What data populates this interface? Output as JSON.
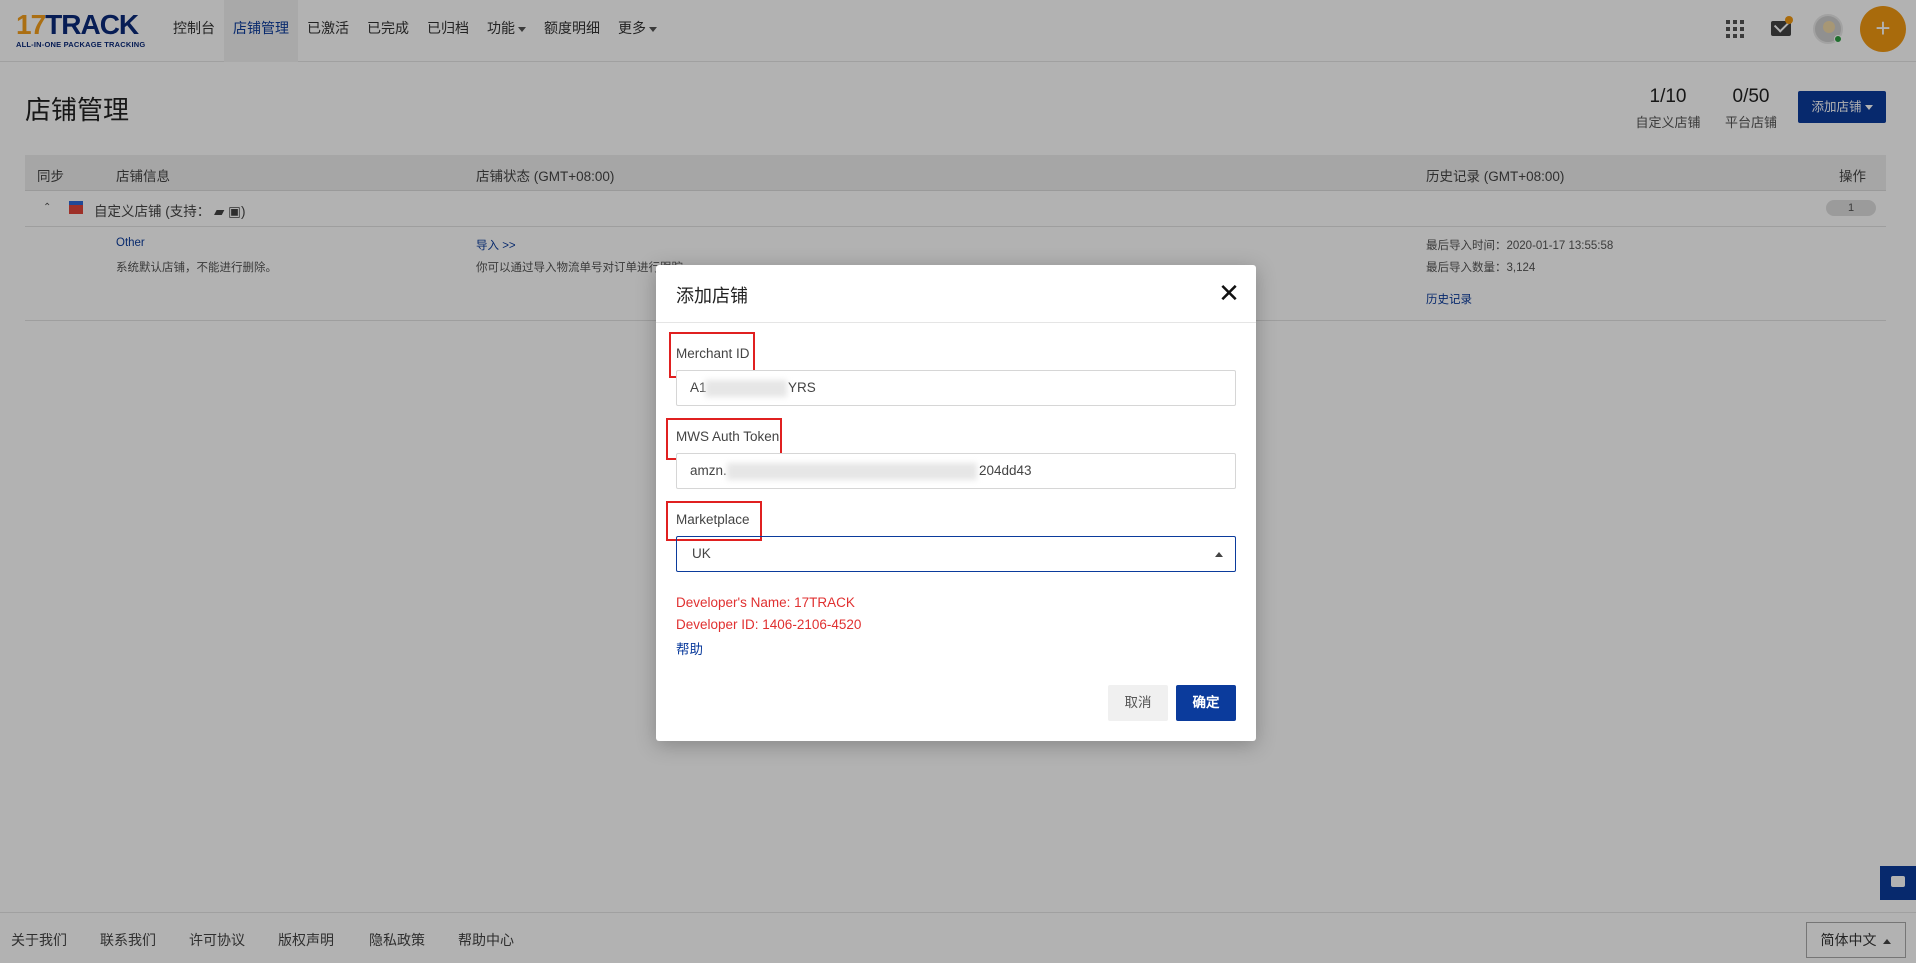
{
  "header": {
    "logo_main_num": "17",
    "logo_main_txt": "TRACK",
    "logo_sub": "ALL-IN-ONE PACKAGE TRACKING",
    "nav": [
      {
        "label": "控制台"
      },
      {
        "label": "店铺管理"
      },
      {
        "label": "已激活"
      },
      {
        "label": "已完成"
      },
      {
        "label": "已归档"
      },
      {
        "label": "功能"
      },
      {
        "label": "额度明细"
      },
      {
        "label": "更多"
      }
    ],
    "plus_label": "+"
  },
  "page": {
    "title": "店铺管理",
    "stats": [
      {
        "value": "1/10",
        "label": "自定义店铺"
      },
      {
        "value": "0/50",
        "label": "平台店铺"
      }
    ],
    "add_store_label": "添加店铺"
  },
  "table": {
    "columns": [
      "同步",
      "店铺信息",
      "店铺状态 (GMT+08:00)",
      "历史记录 (GMT+08:00)",
      "操作"
    ],
    "group": {
      "label": "自定义店铺 (支持：",
      "suffix": ")",
      "count": "1"
    },
    "row": {
      "name": "Other",
      "desc": "系统默认店铺，不能进行删除。",
      "import_link": "导入 >>",
      "import_desc": "你可以通过导入物流单号对订单进行跟踪",
      "last_import_time": "最后导入时间：2020-01-17 13:55:58",
      "last_import_count": "最后导入数量：3,124",
      "history_link": "历史记录"
    }
  },
  "footer": {
    "links": [
      "关于我们",
      "联系我们",
      "许可协议",
      "版权声明",
      "隐私政策",
      "帮助中心"
    ],
    "language": "简体中文"
  },
  "modal": {
    "title": "添加店铺",
    "close": "✕",
    "merchant_label": "Merchant ID",
    "merchant_prefix": "A1",
    "merchant_suffix": "YRS",
    "token_label": "MWS Auth Token",
    "token_prefix": "amzn.",
    "token_suffix": "204dd43",
    "marketplace_label": "Marketplace",
    "marketplace_value": "UK",
    "dev_name": "Developer's Name: 17TRACK",
    "dev_id": "Developer ID: 1406-2106-4520",
    "help": "帮助",
    "cancel": "取消",
    "confirm": "确定"
  },
  "colors": {
    "brand_blue": "#0b3b9c",
    "brand_orange": "#f39a12",
    "highlight_red": "#e02020"
  }
}
